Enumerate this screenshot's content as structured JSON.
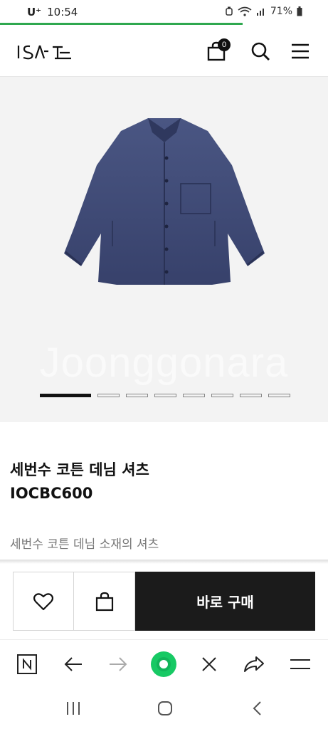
{
  "status_bar": {
    "carrier": "U⁺",
    "time": "10:54",
    "battery": "71%"
  },
  "header": {
    "logo_text": "ISAtc",
    "cart_count": "0"
  },
  "gallery": {
    "watermark": "Joonggonara",
    "slide_count": 8,
    "active_slide": 1
  },
  "product": {
    "name_line1": "세번수 코튼 데님 셔츠",
    "name_line2": "IOCBC600",
    "description": "세번수 코튼 데님 소재의 셔츠"
  },
  "actions": {
    "buy_now_label": "바로 구매"
  },
  "browser_toolbar": {
    "icons": [
      "naver-n-icon",
      "back-arrow-icon",
      "forward-arrow-icon",
      "green-home-icon",
      "close-icon",
      "share-icon",
      "menu-icon"
    ]
  },
  "system_nav": {
    "icons": [
      "recent-apps-icon",
      "home-icon",
      "back-icon"
    ]
  },
  "colors": {
    "progress": "#2fa84f",
    "buy_button": "#1b1b1b",
    "denim": "#3e4a75"
  }
}
